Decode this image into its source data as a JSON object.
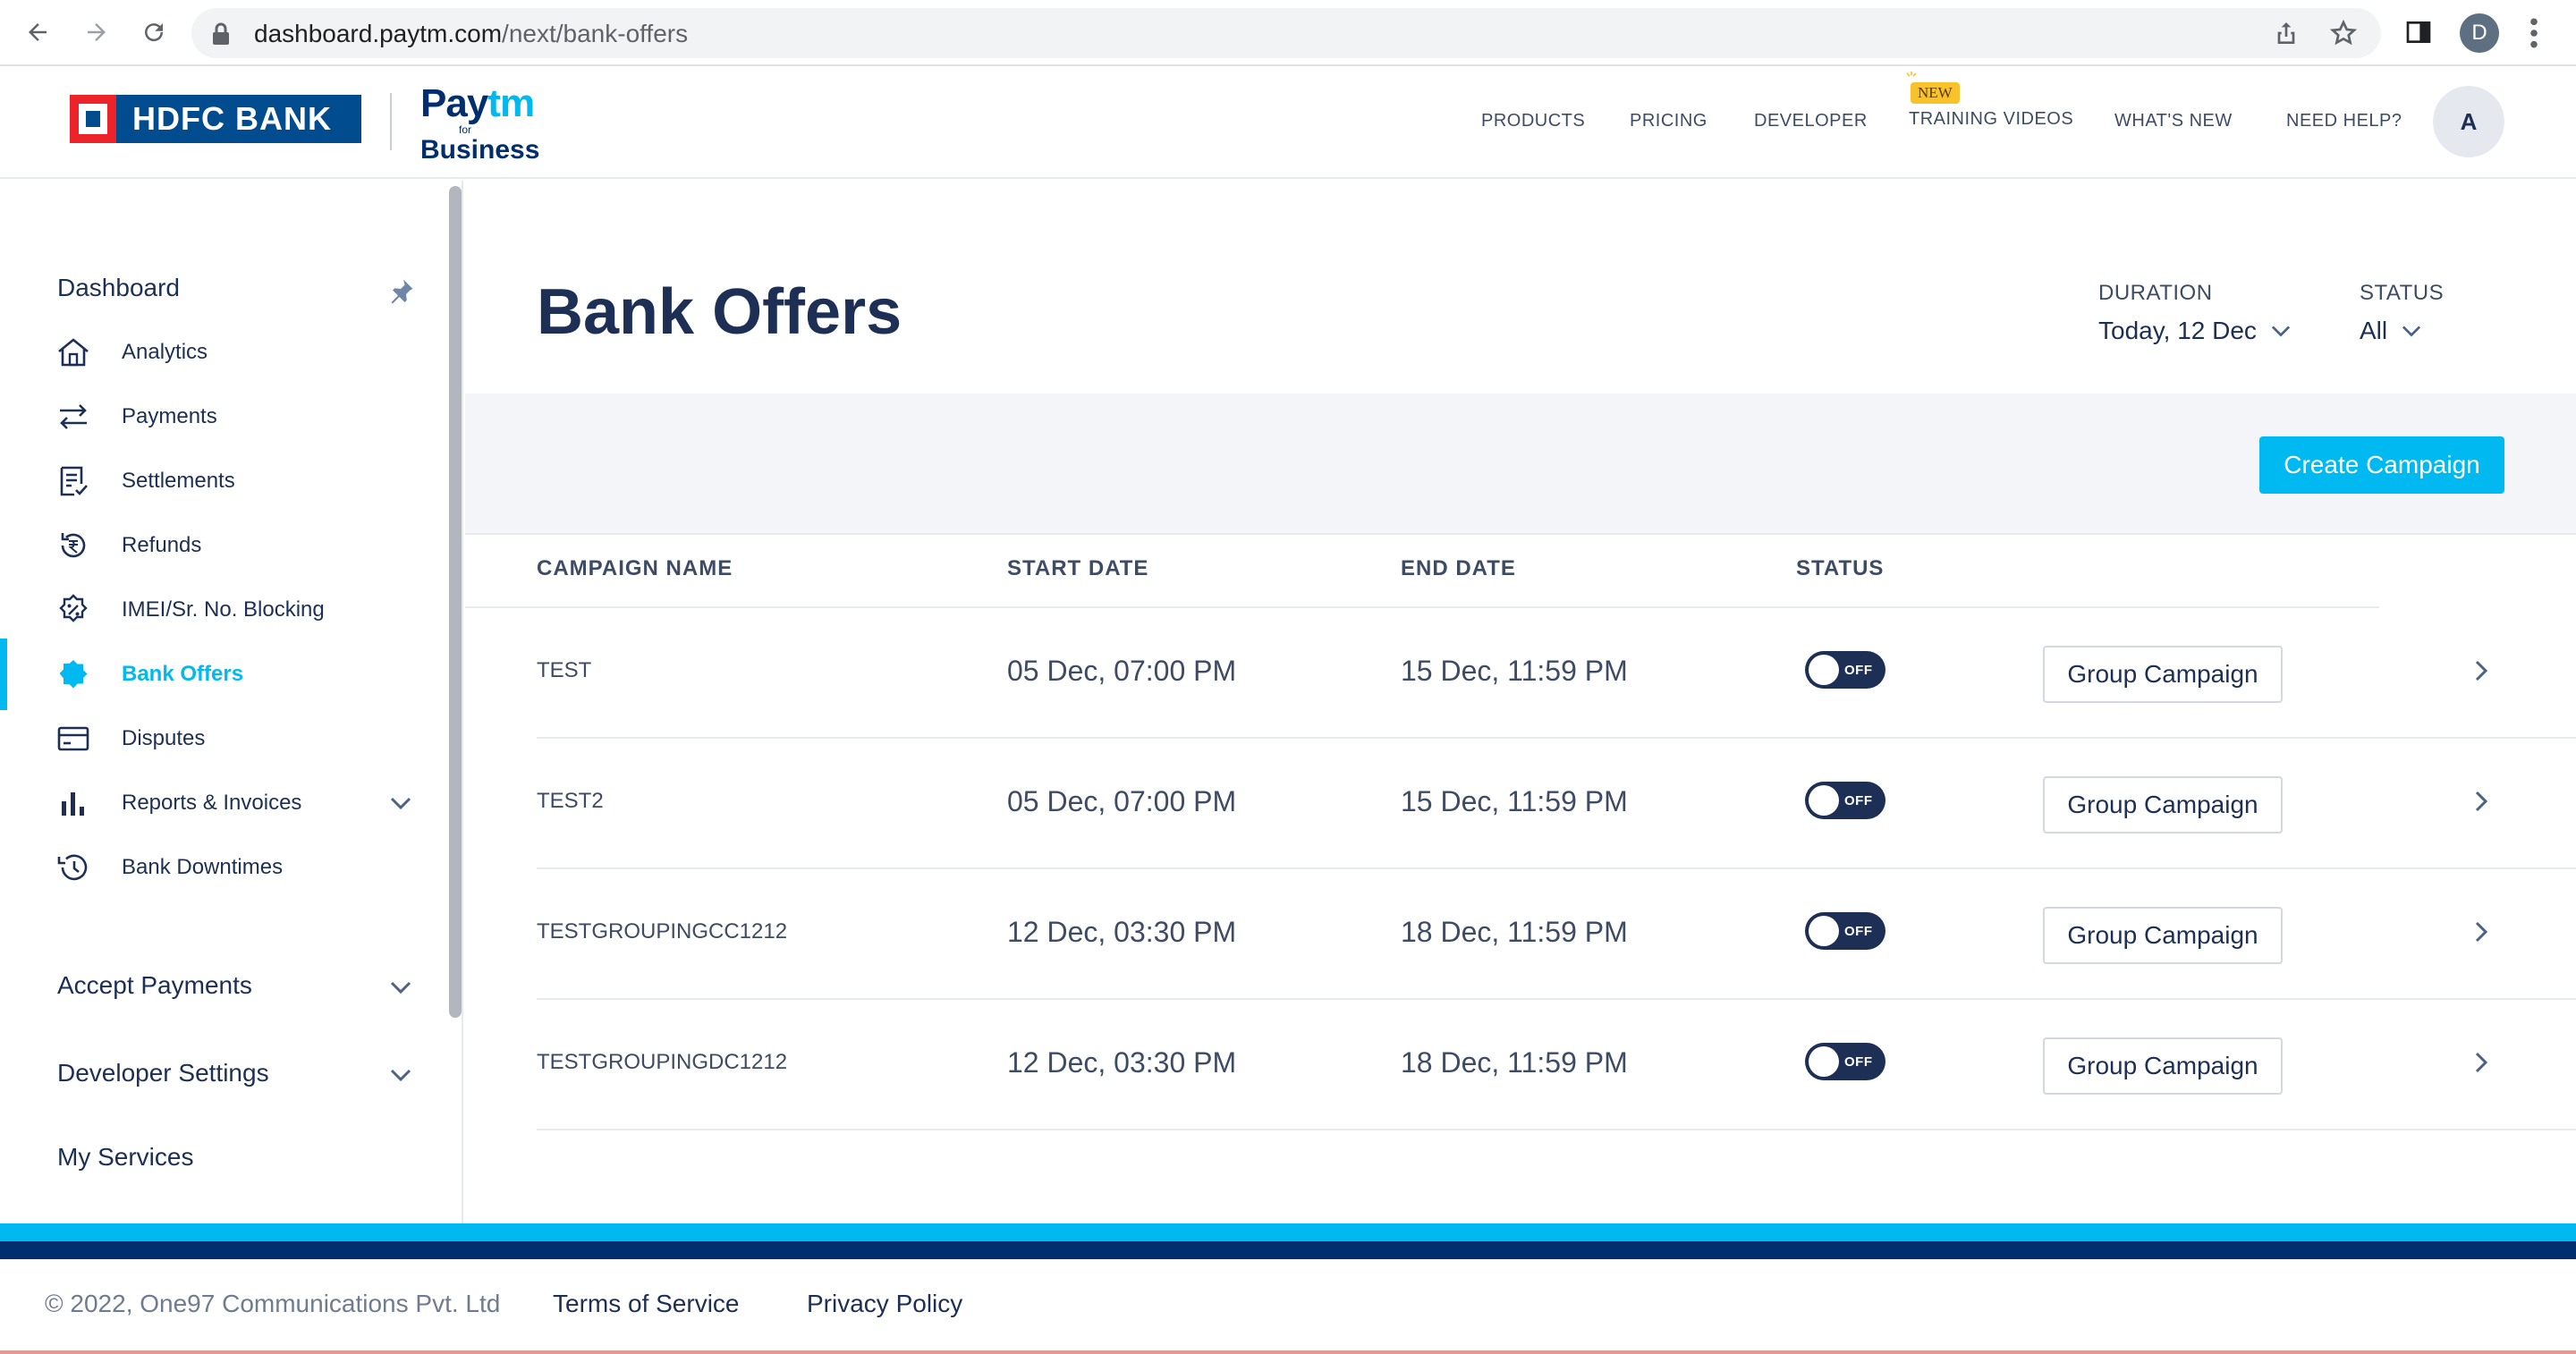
{
  "browser": {
    "url_domain": "dashboard.paytm.com",
    "url_path": "/next/bank-offers",
    "profile_initial": "D"
  },
  "header": {
    "hdfc_logo_text": "HDFC BANK",
    "paytm_logo": {
      "pay": "Pay",
      "tm": "tm",
      "for": "for",
      "business": "Business"
    },
    "nav": [
      {
        "label": "PRODUCTS"
      },
      {
        "label": "PRICING"
      },
      {
        "label": "DEVELOPER"
      },
      {
        "label": "TRAINING VIDEOS",
        "badge": "NEW"
      },
      {
        "label": "WHAT'S NEW"
      },
      {
        "label": "NEED HELP?"
      }
    ],
    "avatar_initial": "A"
  },
  "sidebar": {
    "dashboard_label": "Dashboard",
    "items": [
      {
        "label": "Analytics",
        "icon": "home-icon"
      },
      {
        "label": "Payments",
        "icon": "transfer-arrows-icon"
      },
      {
        "label": "Settlements",
        "icon": "document-check-icon"
      },
      {
        "label": "Refunds",
        "icon": "refund-rupee-icon"
      },
      {
        "label": "IMEI/Sr. No. Blocking",
        "icon": "percent-badge-icon"
      },
      {
        "label": "Bank Offers",
        "icon": "offer-badge-icon",
        "active": true
      },
      {
        "label": "Disputes",
        "icon": "card-icon"
      },
      {
        "label": "Reports & Invoices",
        "icon": "bar-chart-icon",
        "expandable": true
      },
      {
        "label": "Bank Downtimes",
        "icon": "clock-history-icon"
      }
    ],
    "sections": [
      {
        "label": "Accept Payments",
        "expandable": true
      },
      {
        "label": "Developer Settings",
        "expandable": true
      },
      {
        "label": "My Services",
        "expandable": false
      }
    ]
  },
  "main": {
    "title": "Bank Offers",
    "filters": {
      "duration_label": "DURATION",
      "duration_value": "Today, 12 Dec",
      "status_label": "STATUS",
      "status_value": "All"
    },
    "create_button": "Create Campaign",
    "table": {
      "columns": [
        "CAMPAIGN NAME",
        "START DATE",
        "END DATE",
        "STATUS"
      ],
      "rows": [
        {
          "name": "TEST",
          "start": "05 Dec, 07:00 PM",
          "end": "15 Dec, 11:59 PM",
          "status": "OFF",
          "action": "Group Campaign"
        },
        {
          "name": "TEST2",
          "start": "05 Dec, 07:00 PM",
          "end": "15 Dec, 11:59 PM",
          "status": "OFF",
          "action": "Group Campaign"
        },
        {
          "name": "TESTGROUPINGCC1212",
          "start": "12 Dec, 03:30 PM",
          "end": "18 Dec, 11:59 PM",
          "status": "OFF",
          "action": "Group Campaign"
        },
        {
          "name": "TESTGROUPINGDC1212",
          "start": "12 Dec, 03:30 PM",
          "end": "18 Dec, 11:59 PM",
          "status": "OFF",
          "action": "Group Campaign"
        }
      ]
    }
  },
  "footer": {
    "copyright": "© 2022, One97 Communications Pvt. Ltd",
    "links": [
      "Terms of Service",
      "Privacy Policy"
    ]
  },
  "colors": {
    "accent": "#00b9f1",
    "navy": "#002e6e",
    "text": "#1d2f54",
    "toggle_off": "#1d2f54"
  }
}
